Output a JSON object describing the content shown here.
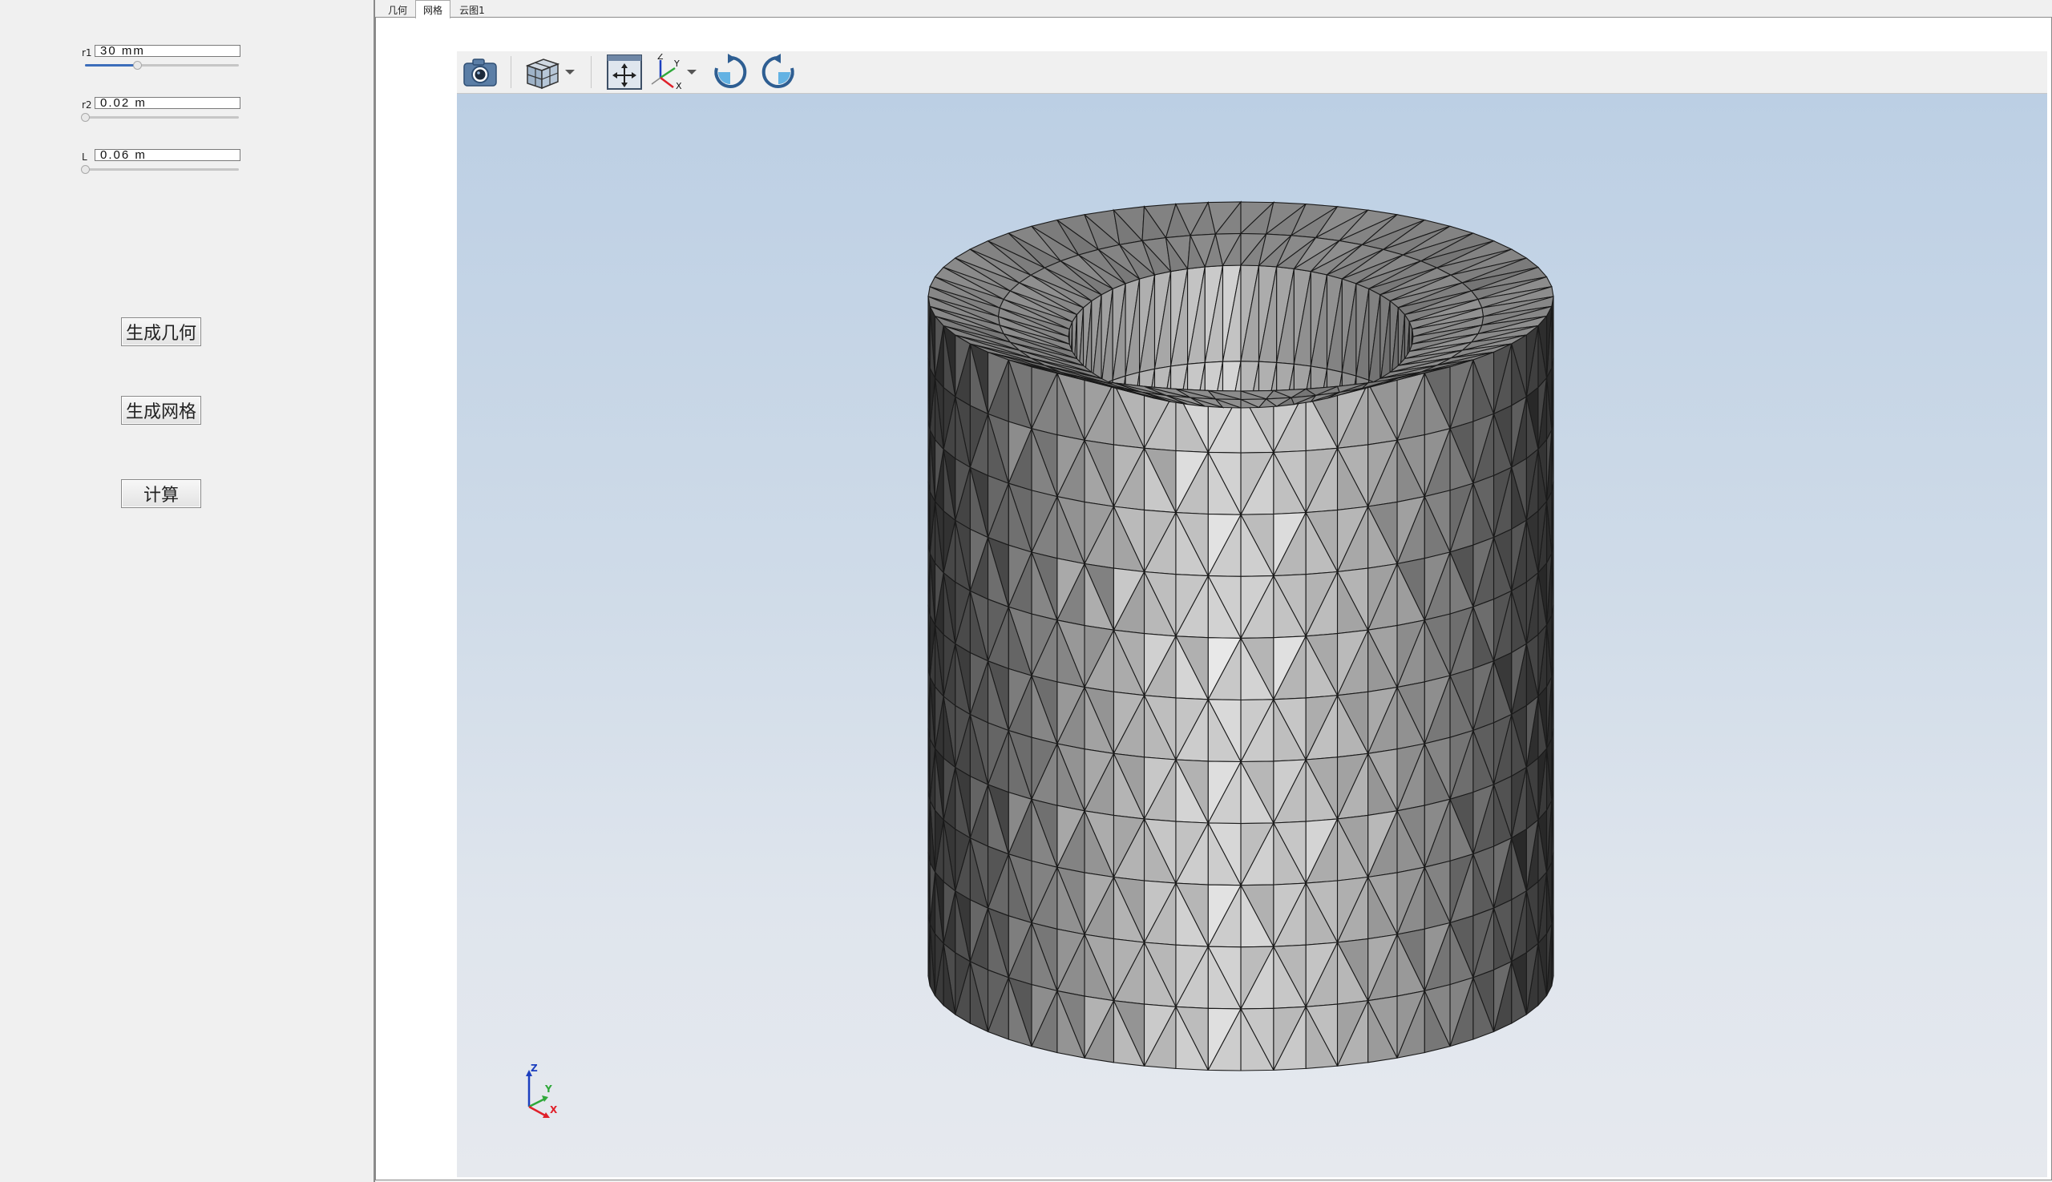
{
  "params": [
    {
      "id": "r1",
      "label": "r1",
      "value": "30 mm",
      "slider": 0.33
    },
    {
      "id": "r2",
      "label": "r2",
      "value": "0.02 m",
      "slider": 0.0
    },
    {
      "id": "L",
      "label": "L",
      "value": "0.06 m",
      "slider": 0.0
    }
  ],
  "buttons": {
    "generate_geometry": "生成几何",
    "generate_mesh": "生成网格",
    "compute": "计算"
  },
  "tabs": [
    {
      "label": "几何",
      "active": false
    },
    {
      "label": "网格",
      "active": true
    },
    {
      "label": "云图1",
      "active": false
    }
  ],
  "toolbar": {
    "icons": [
      "camera-icon",
      "view-cube-icon",
      "dropdown-arrow-icon",
      "fit-view-icon",
      "axes-orientation-icon",
      "dropdown-arrow-icon",
      "rotate-clockwise-icon",
      "rotate-counterclockwise-icon"
    ]
  },
  "triad": {
    "z": "Z",
    "y": "Y",
    "x": "X"
  },
  "colors": {
    "slider_fill": "#3c6dbb",
    "axis_x": "#e0202a",
    "axis_y": "#2fa83a",
    "axis_z": "#1c3fbf",
    "mesh_light": "#d9d9d9",
    "mesh_dark": "#3a3a3a"
  }
}
